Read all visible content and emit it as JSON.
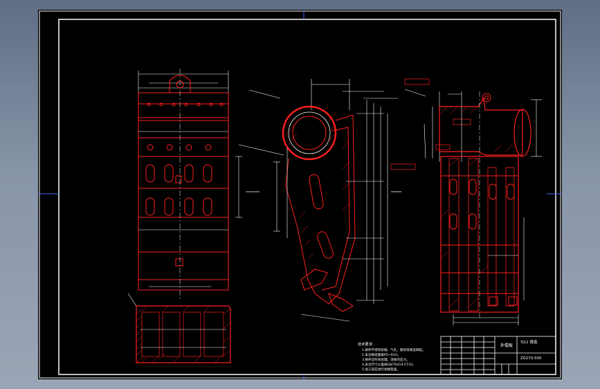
{
  "drawing": {
    "title_block": {
      "part_name": "补偿板",
      "drawing_number": "YJ12 铸造",
      "code": "ZG270-500"
    },
    "technical_requirements": [
      "技术要求：",
      "1.铸件不得有砂眼、气孔、裂纹等铸造缺陷。",
      "2.未注铸造圆角R5~R10。",
      "3.铸件应时效处理，消除内应力。",
      "4.未注尺寸公差按GB/T6414-CT10。",
      "5.加工前应进行划线检查。"
    ],
    "colors": {
      "sheet_background": "#000000",
      "line_primary": "#ff2020",
      "line_secondary": "#ffffff",
      "axis_marker": "#3a6bff"
    }
  }
}
